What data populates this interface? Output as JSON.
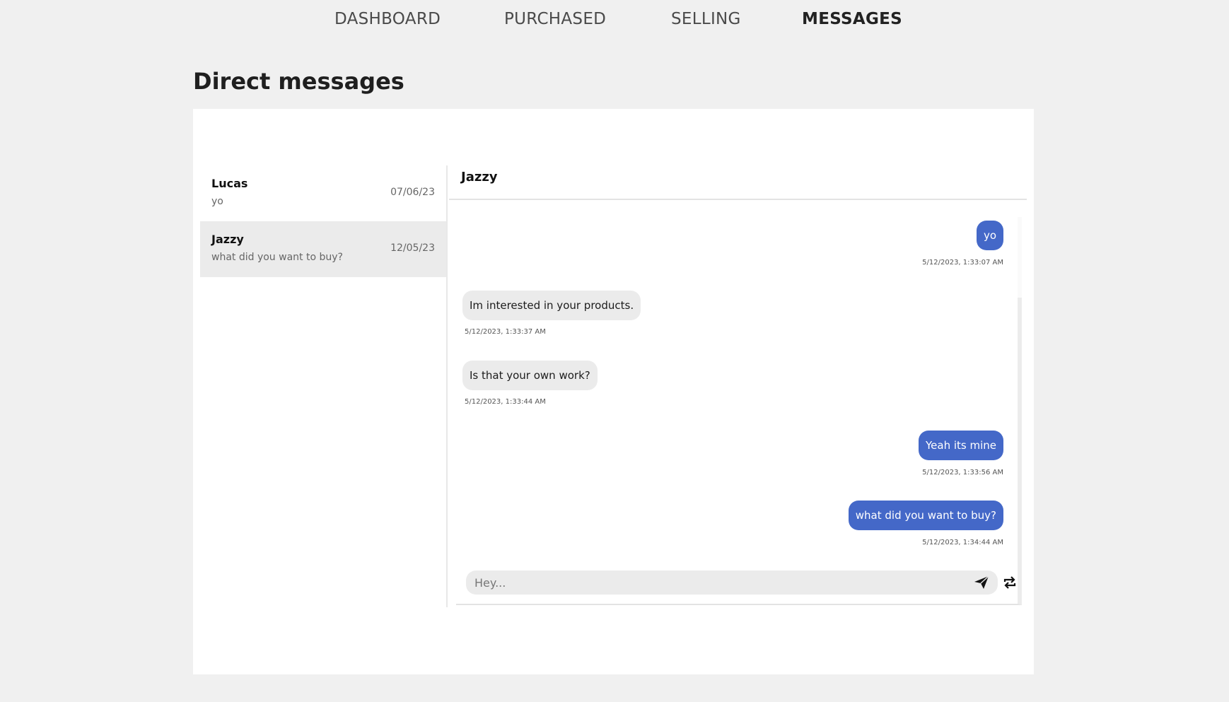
{
  "nav": {
    "items": [
      {
        "label": "DASHBOARD",
        "active": false
      },
      {
        "label": "PURCHASED",
        "active": false
      },
      {
        "label": "SELLING",
        "active": false
      },
      {
        "label": "MESSAGES",
        "active": true
      }
    ]
  },
  "page": {
    "title": "Direct messages"
  },
  "conversations": [
    {
      "name": "Lucas",
      "preview": "yo",
      "date": "07/06/23",
      "selected": false
    },
    {
      "name": "Jazzy",
      "preview": "what did you want to buy?",
      "date": "12/05/23",
      "selected": true
    }
  ],
  "chat": {
    "contact_name": "Jazzy",
    "messages": [
      {
        "text": "yo",
        "timestamp": "5/12/2023, 1:33:07 AM",
        "direction": "sent"
      },
      {
        "text": "Im interested in your products.",
        "timestamp": "5/12/2023, 1:33:37 AM",
        "direction": "received"
      },
      {
        "text": "Is that your own work?",
        "timestamp": "5/12/2023, 1:33:44 AM",
        "direction": "received"
      },
      {
        "text": "Yeah its mine",
        "timestamp": "5/12/2023, 1:33:56 AM",
        "direction": "sent"
      },
      {
        "text": "what did you want to buy?",
        "timestamp": "5/12/2023, 1:34:44 AM",
        "direction": "sent"
      }
    ]
  },
  "composer": {
    "placeholder": "Hey...",
    "value": "",
    "send_icon": "send-icon",
    "refresh_icon": "refresh-icon"
  },
  "colors": {
    "sent_bubble": "#4468c8",
    "received_bubble": "#ebebeb",
    "page_background": "#f0f0f0"
  }
}
